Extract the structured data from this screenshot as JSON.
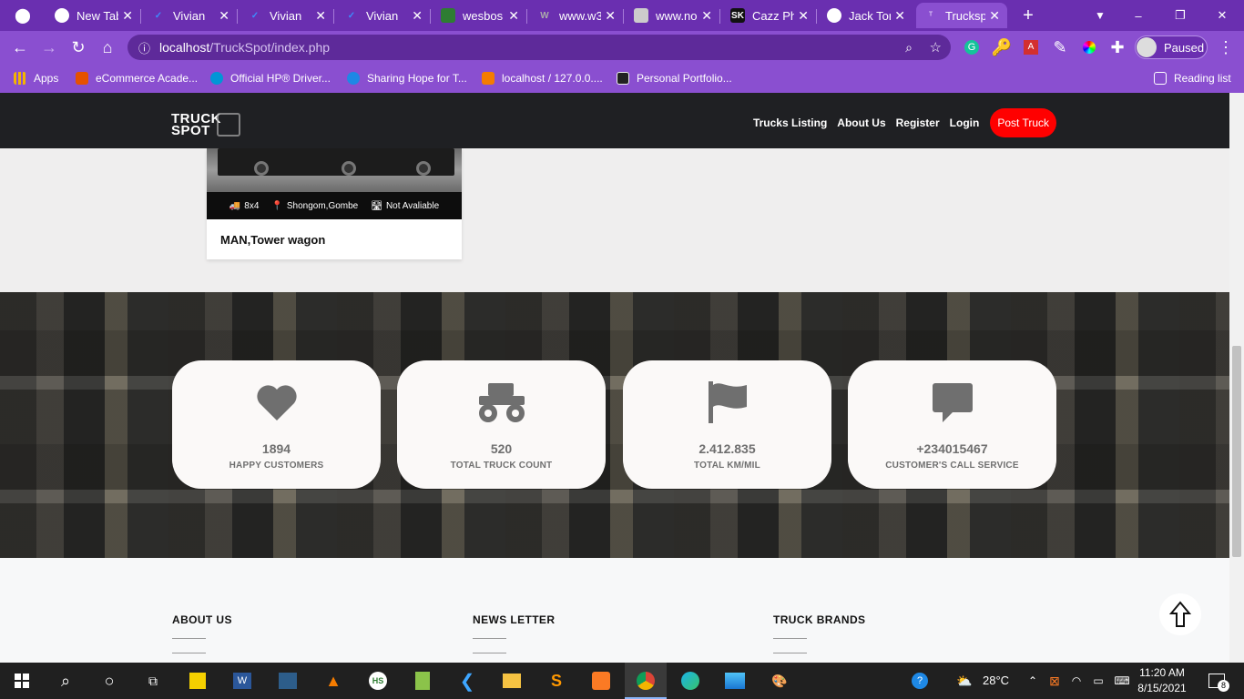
{
  "browser": {
    "tabs": [
      {
        "title": "New Tab",
        "fav_color": "#fff"
      },
      {
        "title": "Vivian",
        "fav_color": "#3d8bfd"
      },
      {
        "title": "Vivian",
        "fav_color": "#3d8bfd"
      },
      {
        "title": "Vivian",
        "fav_color": "#3d8bfd"
      },
      {
        "title": "wesbos",
        "fav_color": "#2e7d32"
      },
      {
        "title": "www.w3",
        "fav_color": "#888"
      },
      {
        "title": "www.no",
        "fav_color": "#ccc"
      },
      {
        "title": "Cazz Ph",
        "fav_color": "#111"
      },
      {
        "title": "Jack Tor",
        "fav_color": "#fff"
      },
      {
        "title": "Trucksp",
        "fav_color": "#d9c3f5"
      }
    ],
    "url_host": "localhost",
    "url_path": "/TruckSpot/index.php",
    "profile_status": "Paused",
    "bookmarks": [
      {
        "label": "Apps",
        "color": "#f4b400"
      },
      {
        "label": "eCommerce Acade...",
        "color": "#e65100"
      },
      {
        "label": "Official HP® Driver...",
        "color": "#0096d6"
      },
      {
        "label": "Sharing Hope for T...",
        "color": "#1e88e5"
      },
      {
        "label": "localhost / 127.0.0....",
        "color": "#f57c00"
      },
      {
        "label": "Personal Portfolio...",
        "color": "#222"
      }
    ],
    "reading_list": "Reading list"
  },
  "site": {
    "logo_line1": "TRUCK",
    "logo_line2": "SPOT",
    "nav": [
      "Trucks Listing",
      "About Us",
      "Register",
      "Login"
    ],
    "post_truck": "Post Truck"
  },
  "card": {
    "axle": "8x4",
    "location": "Shongom,Gombe",
    "availability": "Not Avaliable",
    "title": "MAN,Tower wagon"
  },
  "stats": [
    {
      "icon": "heart-icon",
      "value": "1894",
      "label": "HAPPY CUSTOMERS"
    },
    {
      "icon": "monster-truck-icon",
      "value": "520",
      "label": "TOTAL TRUCK COUNT"
    },
    {
      "icon": "flag-icon",
      "value": "2.412.835",
      "label": "TOTAL KM/MIL"
    },
    {
      "icon": "chat-icon",
      "value": "+234015467",
      "label": "CUSTOMER'S CALL SERVICE"
    }
  ],
  "footer": {
    "about": "ABOUT US",
    "newsletter": "NEWS LETTER",
    "brands": "TRUCK BRANDS"
  },
  "taskbar": {
    "weather": "28°C",
    "time": "11:20 AM",
    "date": "8/15/2021",
    "notifications": "8"
  }
}
